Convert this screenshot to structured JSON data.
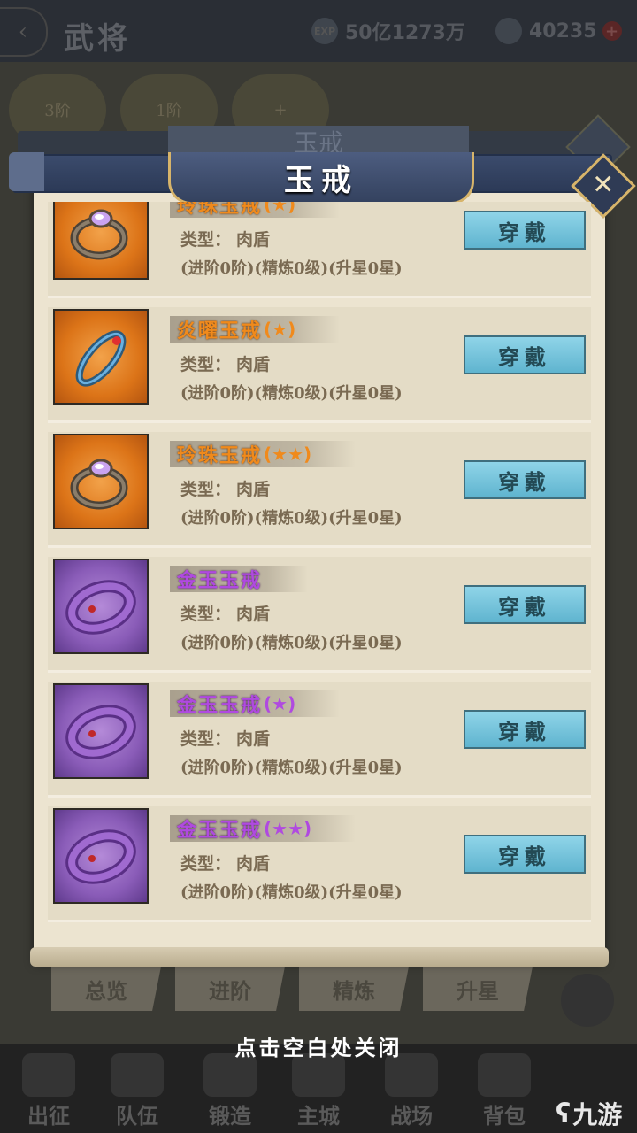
{
  "background": {
    "page_title": "武将",
    "back_icon": "chevron-left-icon",
    "exp_currency": {
      "icon": "exp-coin-icon",
      "icon_label": "EXP",
      "value": "50亿1273万"
    },
    "gold_currency": {
      "icon": "gold-ingot-icon",
      "value": "40235",
      "plus": "+"
    },
    "avatars": [
      {
        "label": "3阶"
      },
      {
        "label": "1阶"
      },
      {
        "label": "+"
      }
    ],
    "tabs": [
      "总览",
      "进阶",
      "精炼",
      "升星"
    ],
    "bottom_nav": [
      "出征",
      "队伍",
      "锻造",
      "主城",
      "战场",
      "背包"
    ]
  },
  "dialog": {
    "title": "玉戒",
    "close_symbol": "✕",
    "items": [
      {
        "name": "玲珠玉戒",
        "stars": "(★)",
        "quality": "orange",
        "icon": "ring-icon",
        "type_label": "类型：",
        "type_value": "肉盾",
        "info": "(进阶0阶)(精炼0级)(升星0星)",
        "button": "穿戴"
      },
      {
        "name": "炎曜玉戒",
        "stars": "(★)",
        "quality": "orange",
        "icon": "ring-icon",
        "type_label": "类型：",
        "type_value": "肉盾",
        "info": "(进阶0阶)(精炼0级)(升星0星)",
        "button": "穿戴"
      },
      {
        "name": "玲珠玉戒",
        "stars": "(★★)",
        "quality": "orange",
        "icon": "ring-icon",
        "type_label": "类型：",
        "type_value": "肉盾",
        "info": "(进阶0阶)(精炼0级)(升星0星)",
        "button": "穿戴"
      },
      {
        "name": "金玉玉戒",
        "stars": "",
        "quality": "purple",
        "icon": "ring-icon",
        "type_label": "类型：",
        "type_value": "肉盾",
        "info": "(进阶0阶)(精炼0级)(升星0星)",
        "button": "穿戴"
      },
      {
        "name": "金玉玉戒",
        "stars": "(★)",
        "quality": "purple",
        "icon": "ring-icon",
        "type_label": "类型：",
        "type_value": "肉盾",
        "info": "(进阶0阶)(精炼0级)(升星0星)",
        "button": "穿戴"
      },
      {
        "name": "金玉玉戒",
        "stars": "(★★)",
        "quality": "purple",
        "icon": "ring-icon",
        "type_label": "类型：",
        "type_value": "肉盾",
        "info": "(进阶0阶)(精炼0级)(升星0星)",
        "button": "穿戴"
      }
    ]
  },
  "close_hint": "点击空白处关闭",
  "watermark": {
    "logo": "九游-logo",
    "text": "九游"
  },
  "colors": {
    "orange_quality": "#f08a1c",
    "purple_quality": "#b04ae0",
    "button_bg": "#7fc8df",
    "paper": "#ece4d0",
    "header_blue": "#34425f",
    "gold_trim": "#d7b46a"
  }
}
